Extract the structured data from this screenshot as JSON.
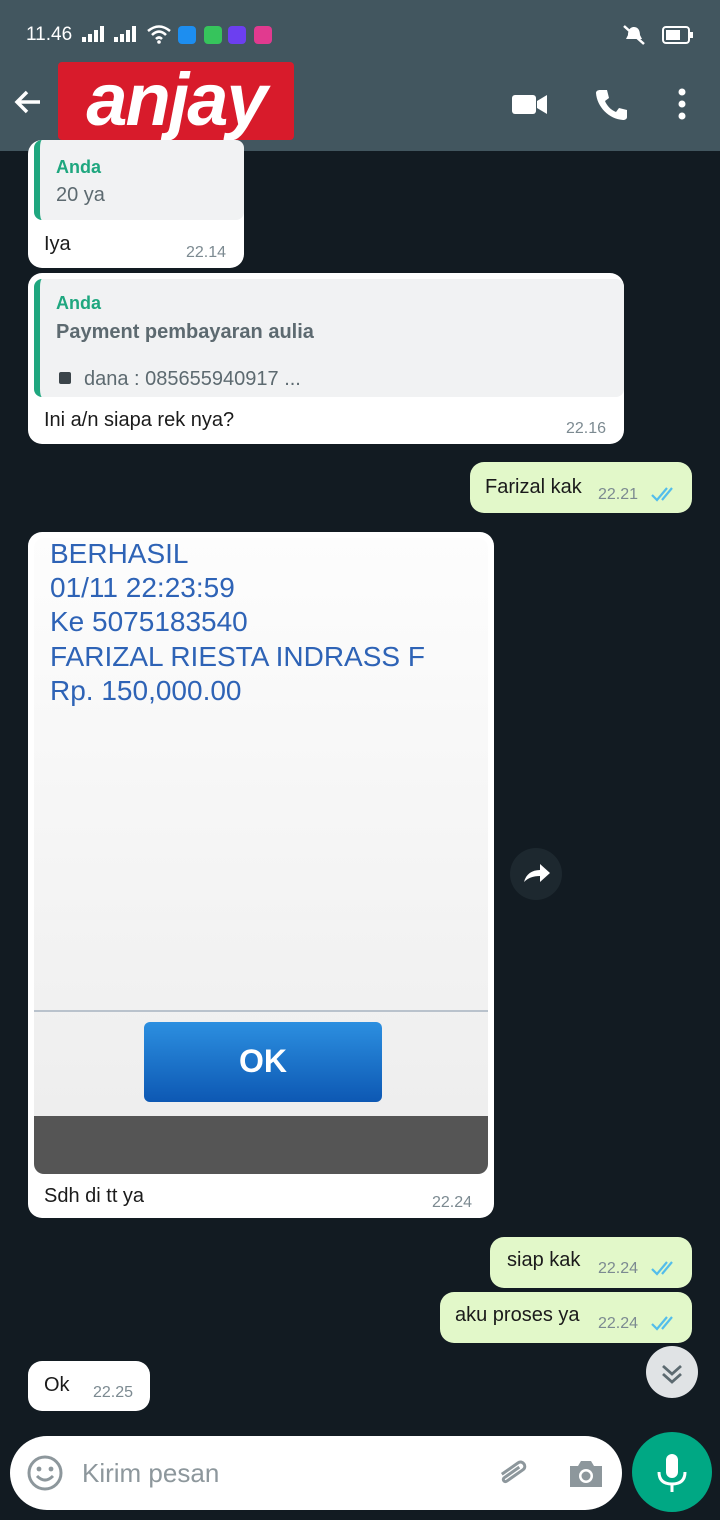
{
  "status_bar": {
    "time": "11.46",
    "app_icon_colors": [
      "#1d8ef0",
      "#36c45c",
      "#6c3ff0",
      "#e13a8f"
    ]
  },
  "header": {
    "logo_text": "anjay",
    "icons": [
      "back-arrow-icon",
      "video-call-icon",
      "phone-icon",
      "more-vert-icon"
    ]
  },
  "messages": [
    {
      "id": "m1",
      "direction": "in",
      "quote_author": "Anda",
      "quote_text": "20 ya",
      "text": "Iya",
      "time": "22.14"
    },
    {
      "id": "m2",
      "direction": "in",
      "quote_author": "Anda",
      "quote_title": "Payment pembayaran aulia",
      "quote_text": "dana : 085655940917 ...",
      "text": "Ini a/n siapa rek nya?",
      "time": "22.16"
    },
    {
      "id": "m3",
      "direction": "out",
      "text": "Farizal kak",
      "time": "22.21"
    },
    {
      "id": "m4",
      "direction": "in",
      "image_lines": [
        "BERHASIL",
        "01/11 22:23:59",
        "Ke 5075183540",
        "FARIZAL RIESTA INDRASS F",
        "Rp. 150,000.00"
      ],
      "image_button": "OK",
      "text": "Sdh di tt ya",
      "time": "22.24"
    },
    {
      "id": "m5",
      "direction": "out",
      "text": "siap kak",
      "time": "22.24"
    },
    {
      "id": "m6",
      "direction": "out",
      "text": "aku proses ya",
      "time": "22.24"
    },
    {
      "id": "m7",
      "direction": "in",
      "text": "Ok",
      "time": "22.25"
    }
  ],
  "composer": {
    "placeholder": "Kirim pesan"
  },
  "colors": {
    "header": "#42565f",
    "chat_bg": "#121b22",
    "outgoing": "#e2f8c9",
    "accent": "#00a884",
    "quote_accent": "#1fa77f",
    "read_ticks": "#53bdeb"
  }
}
